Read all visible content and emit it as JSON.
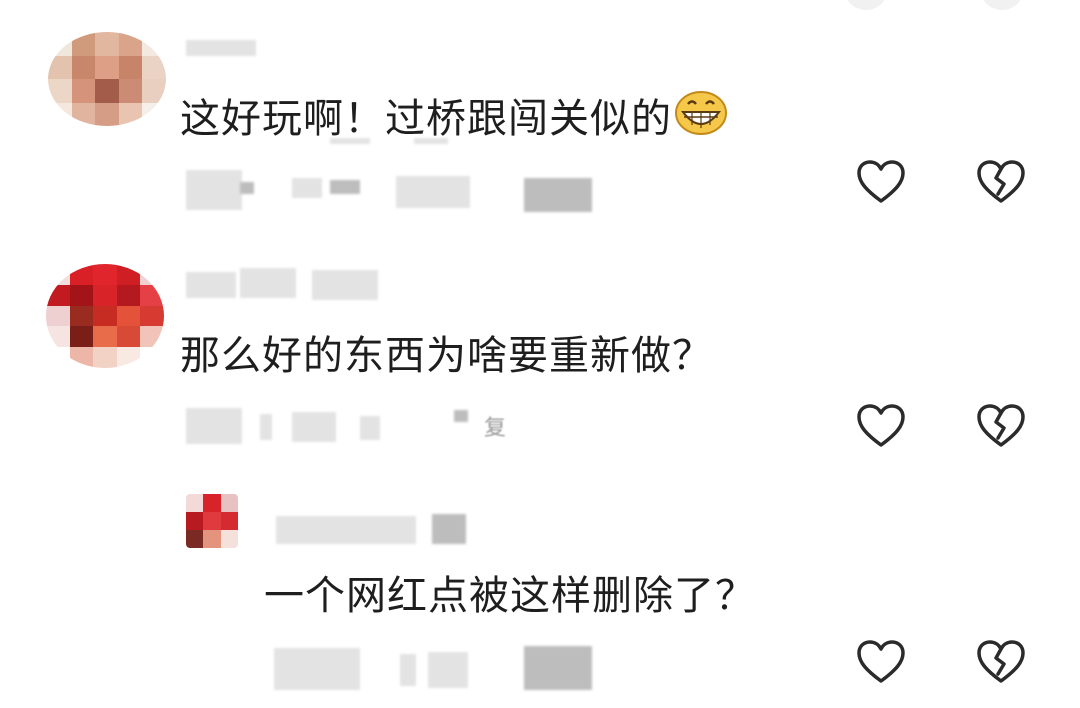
{
  "comments": [
    {
      "text": "这好玩啊！过桥跟闯关似的",
      "emoji": "grinning-face-icon",
      "actions": {
        "like": "heart-icon",
        "dislike": "broken-heart-icon"
      }
    },
    {
      "text": "那么好的东西为啥要重新做？",
      "reply_stub": "复",
      "actions": {
        "like": "heart-icon",
        "dislike": "broken-heart-icon"
      }
    },
    {
      "text": "一个网红点被这样删除了？",
      "is_reply": true,
      "actions": {
        "like": "heart-icon",
        "dislike": "broken-heart-icon"
      }
    }
  ],
  "colors": {
    "text": "#1e1e1e",
    "icon": "#2b2b2b",
    "blurred_meta": "#c8c8c8",
    "emoji_face": "#f6c84a"
  }
}
